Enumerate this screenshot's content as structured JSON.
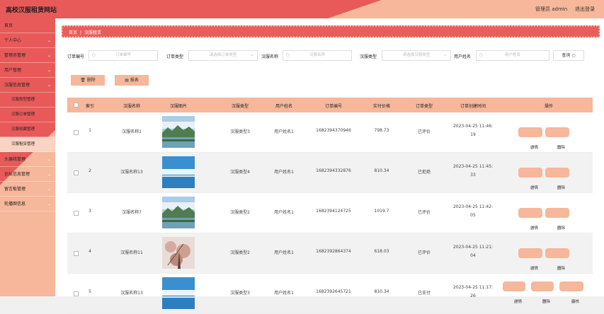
{
  "header": {
    "title": "高校汉服租赁网站",
    "admin": "管理员 admin",
    "logout": "退出登录"
  },
  "sidebar": {
    "items": [
      {
        "label": "首页",
        "chevron": false,
        "sub": false
      },
      {
        "label": "个人中心",
        "chevron": true,
        "sub": false
      },
      {
        "label": "管理员管理",
        "chevron": true,
        "sub": false
      },
      {
        "label": "用户管理",
        "chevron": true,
        "sub": false
      },
      {
        "label": "汉服信息管理",
        "chevron": true,
        "sub": false
      },
      {
        "label": "汉服类型管理",
        "chevron": false,
        "sub": true
      },
      {
        "label": "汉服订单管理",
        "chevron": false,
        "sub": true
      },
      {
        "label": "汉服收藏管理",
        "chevron": false,
        "sub": true
      },
      {
        "label": "汉服租赁管理",
        "chevron": false,
        "sub": true,
        "active": true
      },
      {
        "label": "头展统管理",
        "chevron": true,
        "sub": false
      },
      {
        "label": "论坛信息管理",
        "chevron": true,
        "sub": false
      },
      {
        "label": "留言板管理",
        "chevron": true,
        "sub": false
      },
      {
        "label": "轮播图信息",
        "chevron": true,
        "sub": false
      }
    ]
  },
  "breadcrumb": {
    "home": "首页",
    "sep": "|",
    "current": "汉服租赁"
  },
  "filters": {
    "order_no_label": "订单编号",
    "order_no_placeholder": "订单编号",
    "order_type_label": "订单类型",
    "order_type_placeholder": "请选择订单类型",
    "name_label": "汉服名称",
    "name_placeholder": "汉服名称",
    "hanfu_type_label": "汉服类型",
    "hanfu_type_placeholder": "请选择汉服类型",
    "user_label": "用户姓名",
    "user_placeholder": "用户姓名",
    "search_label": "查询"
  },
  "actions": {
    "delete": "删除",
    "report": "报表"
  },
  "table": {
    "headers": [
      "索引",
      "汉服名称",
      "汉服图片",
      "汉服类型",
      "用户姓名",
      "订单编号",
      "实付价格",
      "订单类型",
      "订单创建时间",
      "操作"
    ],
    "detail_label": "详情",
    "delete_label": "删除",
    "review_label": "审核",
    "rows": [
      {
        "index": "1",
        "name": "汉服名称1",
        "type": "汉服类型3",
        "user": "用户姓名1",
        "order": "1682394370946",
        "price": "798.73",
        "status": "已评价",
        "time1": "2023-04-25 11:46:",
        "time2": "19",
        "pic": "landscape"
      },
      {
        "index": "2",
        "name": "汉服名称13",
        "type": "汉服类型4",
        "user": "用户姓名1",
        "order": "1682394332876",
        "price": "810.34",
        "status": "已拒绝",
        "time1": "2023-04-25 11:45:",
        "time2": "33",
        "pic": "sky"
      },
      {
        "index": "3",
        "name": "汉服名称7",
        "type": "汉服类型2",
        "user": "用户姓名1",
        "order": "1682394124725",
        "price": "1019.7",
        "status": "已评价",
        "time1": "2023-04-25 11:42:",
        "time2": "05",
        "pic": "landscape"
      },
      {
        "index": "4",
        "name": "汉服名称11",
        "type": "汉服类型2",
        "user": "用户姓名1",
        "order": "1682392864374",
        "price": "618.03",
        "status": "已评价",
        "time1": "2023-04-25 11:21:",
        "time2": "04",
        "pic": "blossom"
      },
      {
        "index": "5",
        "name": "汉服名称13",
        "type": "汉服类型3",
        "user": "用户姓名1",
        "order": "1682392645721",
        "price": "810.34",
        "status": "已支付",
        "time1": "2023-04-25 11:17:",
        "time2": "26",
        "pic": "sky"
      }
    ]
  },
  "colors": {
    "red": "#e85a5a",
    "peach": "#f6b79b"
  }
}
